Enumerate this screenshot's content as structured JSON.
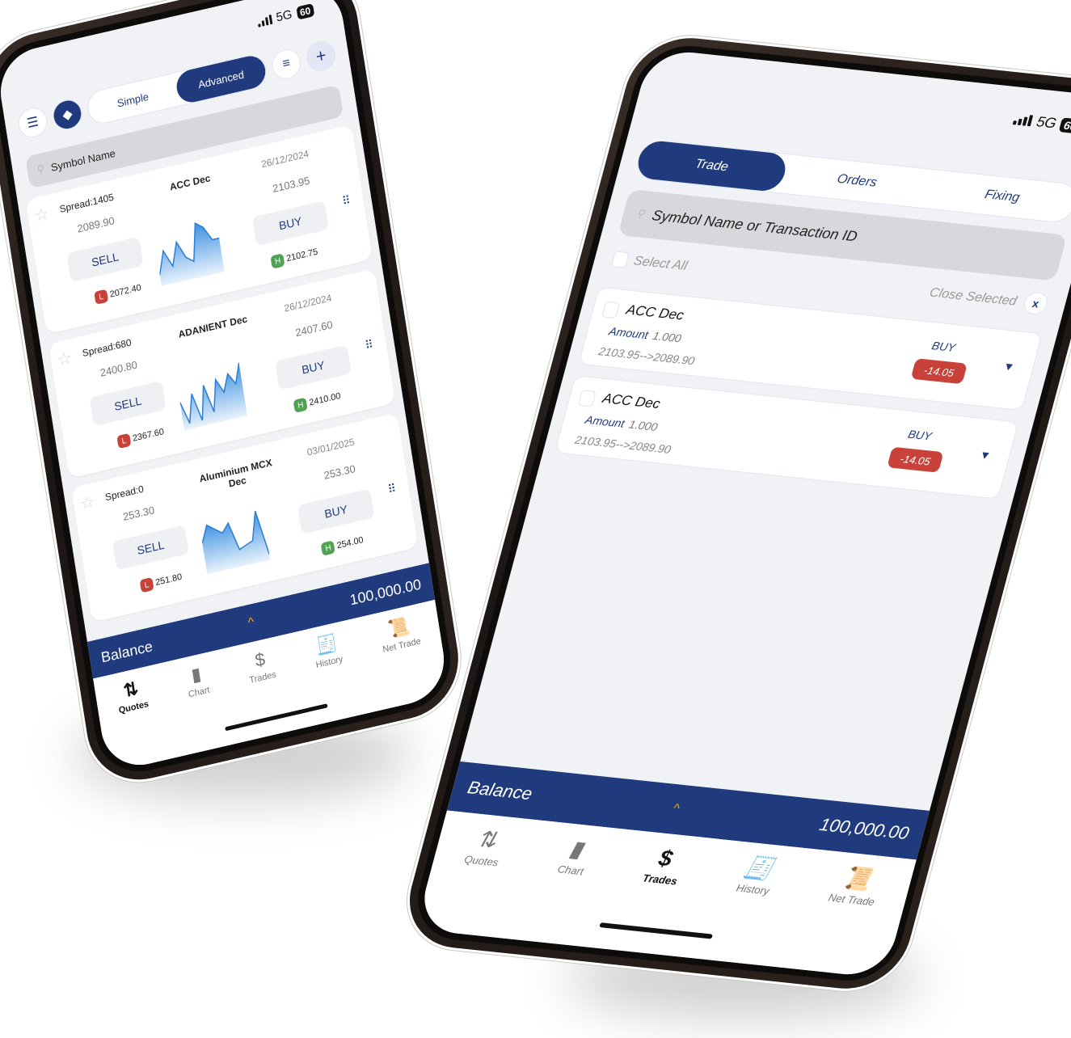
{
  "left_phone": {
    "status": {
      "network": "5G",
      "battery": "60"
    },
    "toolbar": {
      "menu_icon": "menu-icon",
      "logo_icon": "eye-logo-icon",
      "mode_options": [
        "Simple",
        "Advanced"
      ],
      "selected_mode": "Advanced",
      "filter_icon": "filter-icon",
      "add_icon": "plus-icon"
    },
    "search": {
      "placeholder": "Symbol Name"
    },
    "quotes": [
      {
        "symbol": "ACC Dec",
        "spread": "Spread:1405",
        "date": "26/12/2024",
        "bid": "2089.90",
        "ask": "2103.95",
        "sell_label": "SELL",
        "buy_label": "BUY",
        "low_badge": "L",
        "low": "2072.40",
        "high_badge": "H",
        "high": "2102.75",
        "sparkline": [
          0.2,
          0.6,
          0.3,
          0.7,
          0.4,
          0.3,
          0.95,
          0.85,
          0.6,
          0.6
        ]
      },
      {
        "symbol": "ADANIENT Dec",
        "spread": "Spread:680",
        "date": "26/12/2024",
        "bid": "2400.80",
        "ask": "2407.60",
        "sell_label": "SELL",
        "buy_label": "BUY",
        "low_badge": "L",
        "low": "2367.60",
        "high_badge": "H",
        "high": "2410.00",
        "sparkline": [
          0.5,
          0.1,
          0.6,
          0.1,
          0.7,
          0.2,
          0.75,
          0.5,
          0.8,
          0.6,
          0.95
        ]
      },
      {
        "symbol": "Aluminium MCX Dec",
        "spread": "Spread:0",
        "date": "03/01/2025",
        "bid": "253.30",
        "ask": "253.30",
        "sell_label": "SELL",
        "buy_label": "BUY",
        "low_badge": "L",
        "low": "251.80",
        "high_badge": "H",
        "high": "254.00",
        "sparkline": [
          0.55,
          0.85,
          0.75,
          0.65,
          0.8,
          0.3,
          0.35,
          0.4,
          0.9,
          0.1
        ]
      }
    ],
    "balance": {
      "label": "Balance",
      "value": "100,000.00"
    },
    "tabs": [
      {
        "label": "Quotes",
        "icon": "sort-arrows-icon",
        "active": true
      },
      {
        "label": "Chart",
        "icon": "bar-chart-icon",
        "active": false
      },
      {
        "label": "Trades",
        "icon": "trades-icon",
        "active": false
      },
      {
        "label": "History",
        "icon": "history-receipt-icon",
        "active": false
      },
      {
        "label": "Net Trade",
        "icon": "net-trade-receipt-icon",
        "active": false
      }
    ]
  },
  "right_phone": {
    "status": {
      "network": "5G",
      "battery": "60"
    },
    "tabs_top": [
      "Trade",
      "Orders",
      "Fixing"
    ],
    "selected_tab": "Trade",
    "search": {
      "placeholder": "Symbol Name or Transaction ID"
    },
    "select_all_label": "Select All",
    "close_selected_label": "Close Selected",
    "close_icon_glyph": "x",
    "trades": [
      {
        "symbol": "ACC Dec",
        "amount_label": "Amount",
        "amount": "1.000",
        "prices": "2103.95-->2089.90",
        "side": "BUY",
        "pl": "-14.05"
      },
      {
        "symbol": "ACC Dec",
        "amount_label": "Amount",
        "amount": "1.000",
        "prices": "2103.95-->2089.90",
        "side": "BUY",
        "pl": "-14.05"
      }
    ],
    "balance": {
      "label": "Balance",
      "value": "100,000.00"
    },
    "tabs": [
      {
        "label": "Quotes",
        "icon": "sort-arrows-icon",
        "active": false
      },
      {
        "label": "Chart",
        "icon": "bar-chart-icon",
        "active": false
      },
      {
        "label": "Trades",
        "icon": "trades-icon",
        "active": true
      },
      {
        "label": "History",
        "icon": "history-receipt-icon",
        "active": false
      },
      {
        "label": "Net Trade",
        "icon": "net-trade-receipt-icon",
        "active": false
      }
    ]
  },
  "colors": {
    "primary": "#1f3a7d",
    "loss": "#c9423a",
    "gain": "#52a253",
    "accent": "#f0a81a",
    "screen_bg": "#f1f2f5"
  }
}
